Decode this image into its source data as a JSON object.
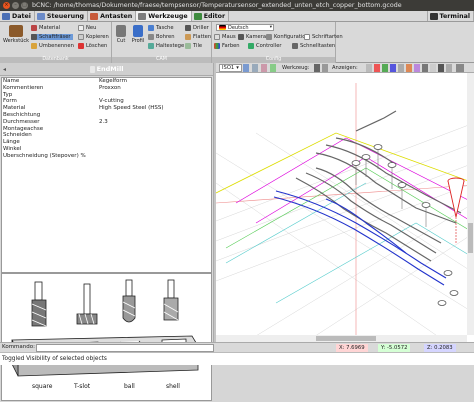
{
  "window": {
    "title": "bCNC: /home/thomas/Dokumente/fraese/tempsensor/Temperatursensor_extended_unten_etch_copper_bottom.gcode"
  },
  "tabs": [
    {
      "label": "Datei",
      "icon": "file-icon",
      "color": "#4a6fb5"
    },
    {
      "label": "Steuerung",
      "icon": "control-icon",
      "color": "#6a8ac8"
    },
    {
      "label": "Antasten",
      "icon": "probe-icon",
      "color": "#c85a3a"
    },
    {
      "label": "Werkzeuge",
      "icon": "tools-icon",
      "color": "#7d7d7d"
    },
    {
      "label": "Editor",
      "icon": "editor-icon",
      "color": "#3d8a3d"
    },
    {
      "label": "Terminal",
      "icon": "terminal-icon",
      "color": "#333333"
    }
  ],
  "ribbon": {
    "database": {
      "big_label": "Werkstück",
      "material": "Material",
      "shaftfraser": "Schaftfräser",
      "umbenennen": "Umbenennen",
      "neu": "Neu",
      "kopieren": "Kopieren",
      "loeschen": "Löschen",
      "group_label": "Datenbank"
    },
    "cam": {
      "cut": "Cut",
      "profil": "Profil",
      "tasche": "Tasche",
      "bohren": "Bohren",
      "haltestege": "Haltestege",
      "driller": "Driller",
      "flatten": "Flatten",
      "tile": "Tile",
      "group_label": "CAM"
    },
    "config": {
      "lang": "Deutsch",
      "maus": "Maus",
      "kamera": "Kamera",
      "konfiguration": "Konfiguration",
      "schriftarten": "Schriftarten",
      "farben": "Farben",
      "controller": "Controller",
      "schnelltasten": "Schnelltasten",
      "group_label": "Config"
    }
  },
  "left": {
    "toolbar_title": "EndMill",
    "properties": [
      {
        "key": "Name",
        "value": "Kegelform"
      },
      {
        "key": "Kommentieren",
        "value": "Proxxon"
      },
      {
        "key": "Typ",
        "value": ""
      },
      {
        "key": "Form",
        "value": "V-cutting"
      },
      {
        "key": "Material",
        "value": "High Speed Steel (HSS)"
      },
      {
        "key": "Beschichtung",
        "value": ""
      },
      {
        "key": "Durchmesser",
        "value": "2.3"
      },
      {
        "key": "Montageachse",
        "value": ""
      },
      {
        "key": "Schneiden",
        "value": ""
      },
      {
        "key": "Länge",
        "value": ""
      },
      {
        "key": "Winkel",
        "value": ""
      },
      {
        "key": "Überschneidung (Stepover) %",
        "value": ""
      }
    ],
    "image_labels": [
      "square",
      "T-slot",
      "ball",
      "shell"
    ]
  },
  "canvas": {
    "view": "ISO1",
    "werkzeug_label": "Werkzeug:",
    "anzeigen_label": "Anzeigen:"
  },
  "command": {
    "label": "Kommando:",
    "x": "X: 7.6969",
    "y": "Y: -5.0572",
    "z": "Z: 0.2083"
  },
  "status": {
    "text": "Toggled Visibility of selected objects"
  }
}
